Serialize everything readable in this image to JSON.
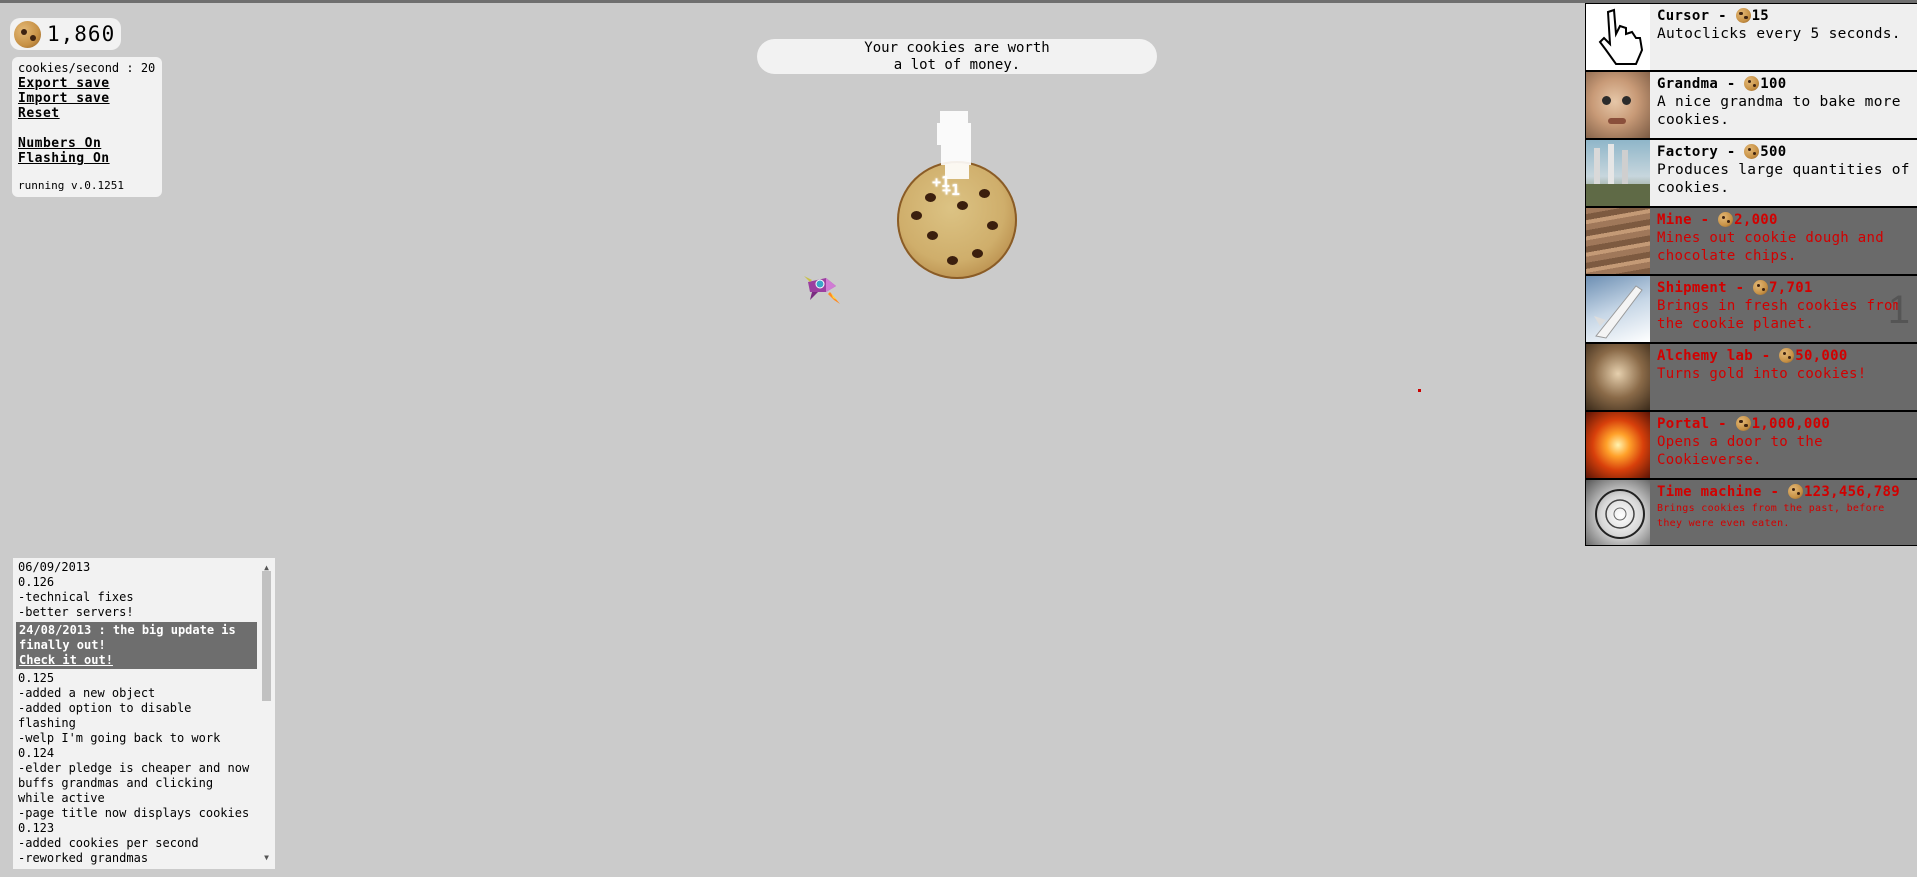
{
  "counter": {
    "value": "1,860"
  },
  "stats": {
    "cps": "cookies/second : 20",
    "export_save": "Export save",
    "import_save": "Import save",
    "reset": "Reset",
    "numbers_toggle": "Numbers On",
    "flashing_toggle": "Flashing On",
    "version": "running v.0.1251"
  },
  "news": {
    "line1": "Your cookies are worth",
    "line2": "a lot of money."
  },
  "big_cookie": {
    "float_texts": [
      "+1",
      "+1"
    ]
  },
  "store": {
    "items": [
      {
        "name": "Cursor",
        "price": "15",
        "desc": "Autoclicks every 5 seconds.",
        "locked": false
      },
      {
        "name": "Grandma",
        "price": "100",
        "desc": "A nice grandma to bake more cookies.",
        "locked": false
      },
      {
        "name": "Factory",
        "price": "500",
        "desc": "Produces large quantities of cookies.",
        "locked": false
      },
      {
        "name": "Mine",
        "price": "2,000",
        "desc": "Mines out cookie dough and chocolate chips.",
        "locked": true
      },
      {
        "name": "Shipment",
        "price": "7,701",
        "desc": "Brings in fresh cookies from the cookie planet.",
        "locked": true,
        "owned_count": "1"
      },
      {
        "name": "Alchemy lab",
        "price": "50,000",
        "desc": "Turns gold into cookies!",
        "locked": true
      },
      {
        "name": "Portal",
        "price": "1,000,000",
        "desc": "Opens a door to the Cookieverse.",
        "locked": true
      },
      {
        "name": "Time machine",
        "price": "123,456,789",
        "desc": "Brings cookies from the past, before they were even eaten.",
        "locked": true
      }
    ]
  },
  "updates": {
    "pre": [
      "06/09/2013",
      "0.126",
      "-technical fixes",
      "-better servers!"
    ],
    "highlight_text": "24/08/2013 : the big update is finally out!",
    "highlight_link": "Check it out!",
    "post": [
      "0.125",
      "-added a new object",
      "-added option to disable flashing",
      "-welp I'm going back to work",
      "0.124",
      "-elder pledge is cheaper and now buffs grandmas and clicking while active",
      "-page title now displays cookies",
      "0.123",
      "-added cookies per second",
      "-reworked grandmas"
    ]
  }
}
